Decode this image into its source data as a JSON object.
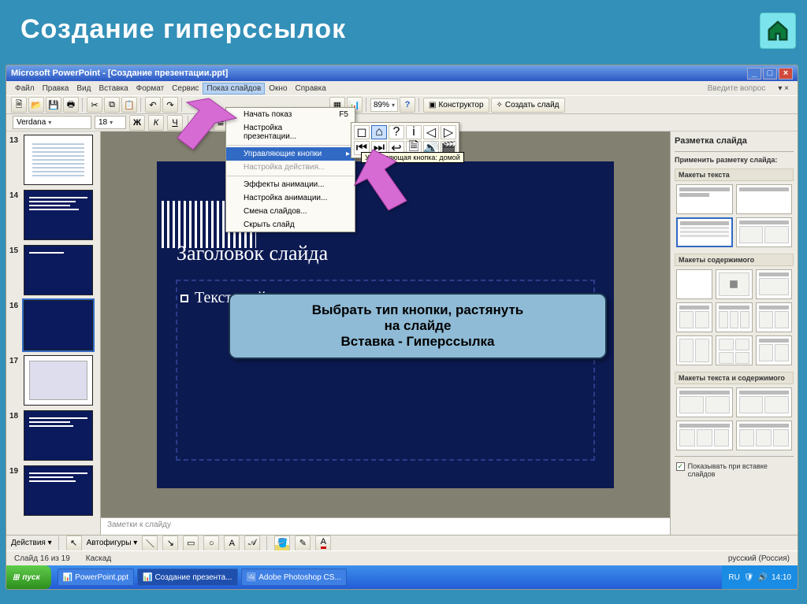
{
  "page": {
    "title": "Создание гиперссылок"
  },
  "titlebar": "Microsoft PowerPoint - [Создание презентации.ppt]",
  "menus": {
    "file": "Файл",
    "edit": "Правка",
    "view": "Вид",
    "insert": "Вставка",
    "format": "Формат",
    "tools": "Сервис",
    "slideshow": "Показ слайдов",
    "window": "Окно",
    "help": "Справка",
    "hint": "Введите вопрос"
  },
  "toolbar": {
    "zoom": "89%",
    "konstructor": "Конструктор",
    "new_slide": "Создать слайд"
  },
  "format_row": {
    "font": "Verdana",
    "size": "18"
  },
  "dropdown": {
    "start": "Начать показ",
    "start_sc": "F5",
    "setup": "Настройка презентации...",
    "buttons": "Управляющие кнопки",
    "action": "Настройка действия...",
    "effects": "Эффекты анимации...",
    "anim": "Настройка анимации...",
    "scheme": "Смена слайдов...",
    "hide": "Скрыть слайд"
  },
  "tooltip": "Управляющая кнопка: домой",
  "slide": {
    "title": "Заголовок слайда",
    "body": "Текст слайда"
  },
  "tip": {
    "l1": "Выбрать тип кнопки, растянуть",
    "l2": "на слайде",
    "l3": "Вставка - Гиперссылка"
  },
  "thumbs": [
    "13",
    "14",
    "15",
    "16",
    "17",
    "18",
    "19"
  ],
  "taskpane": {
    "header": "Разметка слайда",
    "apply": "Применить разметку слайда:",
    "g1": "Макеты текста",
    "g2": "Макеты содержимого",
    "g3": "Макеты текста и содержимого",
    "check": "Показывать при вставке слайдов"
  },
  "notes": "Заметки к слайду",
  "bottom": {
    "actions": "Действия",
    "autoshapes": "Автофигуры"
  },
  "status": {
    "slide": "Слайд 16 из 19",
    "mode": "Каскад",
    "lang": "русский (Россия)"
  },
  "taskbar": {
    "start": "пуск",
    "i1": "PowerPoint.ppt",
    "i2": "Создание презента...",
    "i3": "Adobe Photoshop CS...",
    "lang": "RU",
    "time": "14:10"
  }
}
